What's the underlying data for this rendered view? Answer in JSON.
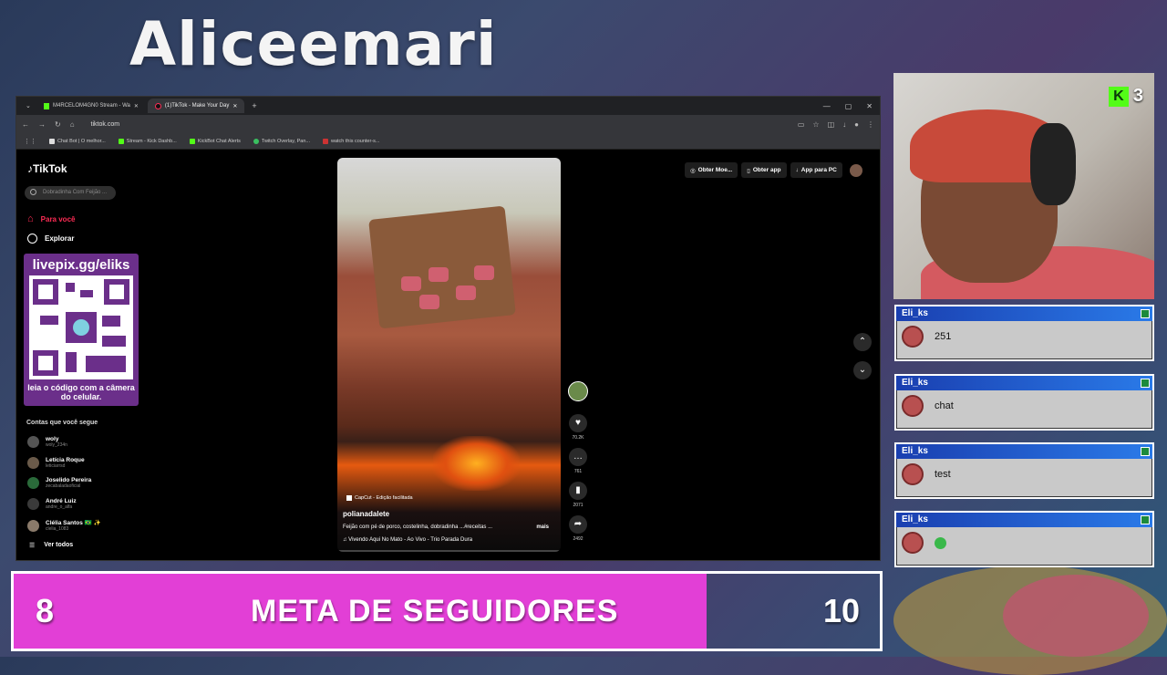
{
  "overlay": {
    "streamer_name": "Aliceemari"
  },
  "browser": {
    "tabs": [
      {
        "label": "M4RCELOM4GN0 Stream - Wa",
        "active": false
      },
      {
        "label": "(1)TikTok - Make Your Day",
        "active": true
      }
    ],
    "url": "tiktok.com",
    "bookmarks": [
      "Chat Bot | O melhor...",
      "Stream - Kick Dashb...",
      "KickBot Chat Alerts",
      "Twitch Overlay, Pan...",
      "watch this counter-s..."
    ]
  },
  "tiktok": {
    "logo": "TikTok",
    "search_placeholder": "Dobradinha Com Feijão ...",
    "nav": {
      "home": "Para você",
      "explore": "Explorar"
    },
    "following_header": "Contas que você segue",
    "accounts": [
      {
        "name": "woly",
        "handle": "woly_234n"
      },
      {
        "name": "Letícia Roque",
        "handle": "leticiarrsd"
      },
      {
        "name": "Joselido Pereira",
        "handle": "zecabaladaoficial"
      },
      {
        "name": "André Luiz",
        "handle": "andre_o_alfa"
      },
      {
        "name": "Clélia Santos 🇧🇷 ✨",
        "handle": "clelia_1083"
      }
    ],
    "see_all": "Ver todos",
    "top_actions": {
      "moedas": "Obter Moe...",
      "app": "Obter app",
      "pc": "App para PC"
    },
    "video": {
      "capcut": "CapCut - Edição facilitada",
      "author": "polianadalete",
      "description": "Feijão com pé de porco, costelinha, dobradinha ...#receitas ...",
      "more": "mais",
      "music": "Vivendo Aqui No Mato - Ao Vivo - Trio Parada Dura"
    },
    "counts": {
      "likes": "70.2K",
      "comments": "761",
      "saves": "2071",
      "shares": "2492"
    }
  },
  "qr": {
    "title": "livepix.gg/eliks",
    "caption": "leia o código com a câmera do celular."
  },
  "cam": {
    "badge_count": "3"
  },
  "chat": [
    {
      "user": "Eli_ks",
      "message": "251"
    },
    {
      "user": "Eli_ks",
      "message": "chat"
    },
    {
      "user": "Eli_ks",
      "message": "test"
    },
    {
      "user": "Eli_ks",
      "message": ""
    }
  ],
  "goal": {
    "current": "8",
    "title": "META DE SEGUIDORES",
    "target": "10",
    "progress": 0.8
  },
  "colors": {
    "goal_fill": "#e23fd6",
    "tiktok_red": "#fe2c55",
    "kick_green": "#53fc18"
  }
}
